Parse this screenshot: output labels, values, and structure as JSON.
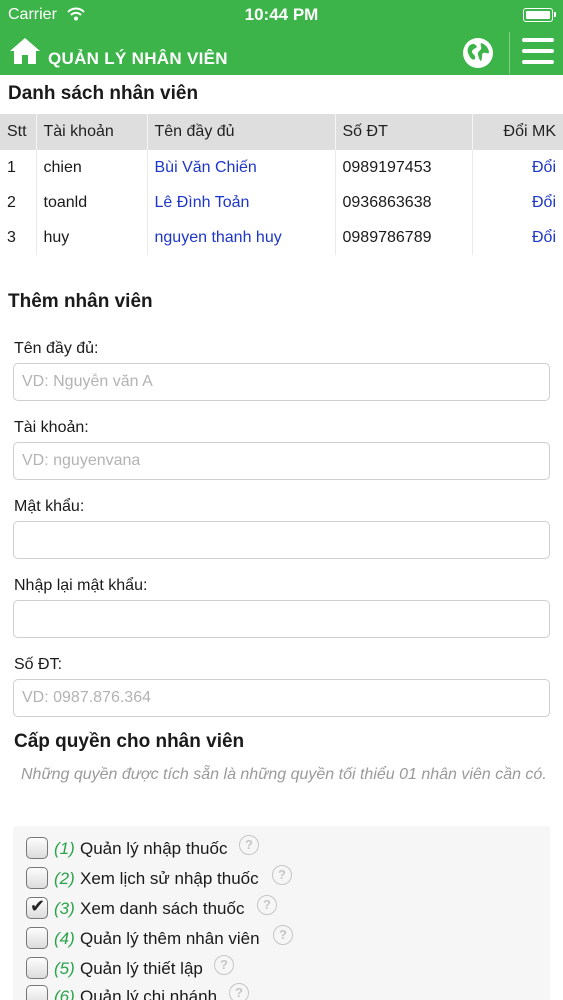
{
  "status_bar": {
    "carrier": "Carrier",
    "time": "10:44 PM"
  },
  "header": {
    "title": "QUẢN LÝ NHÂN VIÊN",
    "brand_color": "#3cb44a"
  },
  "employee_list": {
    "title": "Danh sách nhân viên",
    "columns": [
      "Stt",
      "Tài khoản",
      "Tên đầy đủ",
      "Số ĐT",
      "Đổi MK"
    ],
    "rows": [
      {
        "stt": "1",
        "account": "chien",
        "full_name": "Bùi Văn Chiến",
        "phone": "0989197453",
        "action": "Đổi"
      },
      {
        "stt": "2",
        "account": "toanld",
        "full_name": "Lê Đình Toản",
        "phone": "0936863638",
        "action": "Đổi"
      },
      {
        "stt": "3",
        "account": "huy",
        "full_name": "nguyen thanh huy",
        "phone": "0989786789",
        "action": "Đổi"
      }
    ]
  },
  "add_form": {
    "title": "Thêm nhân viên",
    "full_name": {
      "label": "Tên đầy đủ:",
      "placeholder": "VD: Nguyễn văn A",
      "value": ""
    },
    "account": {
      "label": "Tài khoản:",
      "placeholder": "VD: nguyenvana",
      "value": ""
    },
    "password": {
      "label": "Mật khẩu:",
      "placeholder": "",
      "value": ""
    },
    "confirm_password": {
      "label": "Nhập lại mật khẩu:",
      "placeholder": "",
      "value": ""
    },
    "phone": {
      "label": "Số ĐT:",
      "placeholder": "VD: 0987.876.364",
      "value": ""
    }
  },
  "permissions": {
    "title": "Cấp quyền cho nhân viên",
    "note": "Những quyền được tích sẵn là những quyền tối thiểu 01 nhân viên cần có.",
    "items": [
      {
        "num": "(1)",
        "label": "Quản lý nhập thuốc",
        "checked": false
      },
      {
        "num": "(2)",
        "label": "Xem lịch sử nhập thuốc",
        "checked": false
      },
      {
        "num": "(3)",
        "label": "Xem danh sách thuốc",
        "checked": true
      },
      {
        "num": "(4)",
        "label": "Quản lý thêm nhân viên",
        "checked": false
      },
      {
        "num": "(5)",
        "label": "Quản lý thiết lập",
        "checked": false
      },
      {
        "num": "(6)",
        "label": "Quản lý chi nhánh",
        "checked": false
      }
    ]
  }
}
